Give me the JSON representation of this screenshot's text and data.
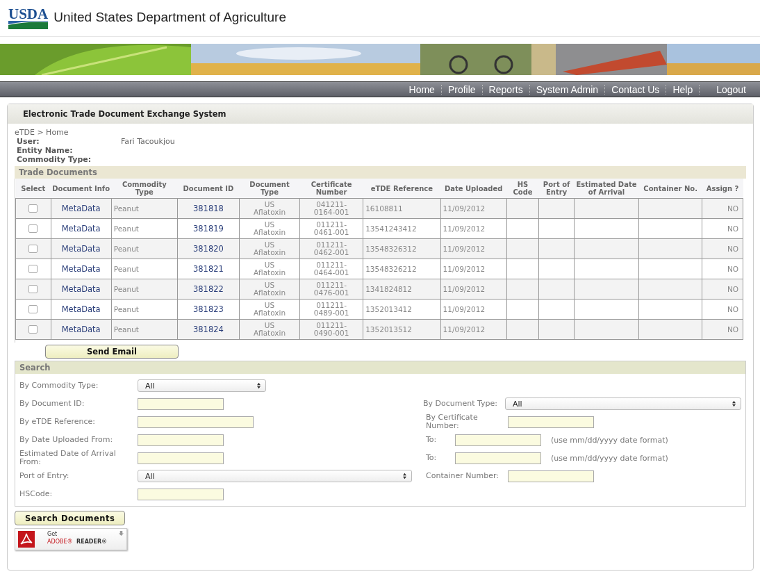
{
  "header": {
    "logo": "USDA",
    "title": "United States Department of Agriculture"
  },
  "nav": {
    "items": [
      "Home",
      "Profile",
      "Reports",
      "System Admin",
      "Contact Us",
      "Help"
    ],
    "logout": "Logout"
  },
  "panel": {
    "title": "Electronic Trade Document Exchange System",
    "breadcrumb": "eTDE > Home",
    "info": [
      {
        "label": "User:",
        "value": "Fari Tacoukjou"
      },
      {
        "label": "Entity Name:"
      },
      {
        "label": "Commodity Type:"
      }
    ]
  },
  "trade_documents": {
    "title": "Trade Documents",
    "columns": [
      "Select",
      "Document Info",
      "Commodity Type",
      "Document ID",
      "Document Type",
      "Certificate Number",
      "eTDE Reference",
      "Date Uploaded",
      "HS Code",
      "Port of Entry",
      "Estimated Date of Arrival",
      "Container No.",
      "Assign ?"
    ],
    "rows": [
      {
        "checked": false,
        "info": "MetaData",
        "commodity": "Peanut",
        "document_id": "381818",
        "document_type": "US Aflatoxin",
        "certificate_number": "041211-0164-001",
        "etde_reference": "16108811",
        "date_uploaded": "11/09/2012",
        "assign": "NO"
      },
      {
        "checked": false,
        "info": "MetaData",
        "commodity": "Peanut",
        "document_id": "381819",
        "document_type": "US Aflatoxin",
        "certificate_number": "011211-0461-001",
        "etde_reference": "13541243412",
        "date_uploaded": "11/09/2012",
        "assign": "NO"
      },
      {
        "checked": false,
        "info": "MetaData",
        "commodity": "Peanut",
        "document_id": "381820",
        "document_type": "US Aflatoxin",
        "certificate_number": "011211-0462-001",
        "etde_reference": "13548326312",
        "date_uploaded": "11/09/2012",
        "assign": "NO"
      },
      {
        "checked": false,
        "info": "MetaData",
        "commodity": "Peanut",
        "document_id": "381821",
        "document_type": "US Aflatoxin",
        "certificate_number": "011211-0464-001",
        "etde_reference": "13548326212",
        "date_uploaded": "11/09/2012",
        "assign": "NO"
      },
      {
        "checked": false,
        "info": "MetaData",
        "commodity": "Peanut",
        "document_id": "381822",
        "document_type": "US Aflatoxin",
        "certificate_number": "011211-0476-001",
        "etde_reference": "1341824812",
        "date_uploaded": "11/09/2012",
        "assign": "NO"
      },
      {
        "checked": false,
        "info": "MetaData",
        "commodity": "Peanut",
        "document_id": "381823",
        "document_type": "US Aflatoxin",
        "certificate_number": "011211-0489-001",
        "etde_reference": "1352013412",
        "date_uploaded": "11/09/2012",
        "assign": "NO"
      },
      {
        "checked": false,
        "info": "MetaData",
        "commodity": "Peanut",
        "document_id": "381824",
        "document_type": "US Aflatoxin",
        "certificate_number": "011211-0490-001",
        "etde_reference": "1352013512",
        "date_uploaded": "11/09/2012",
        "assign": "NO"
      }
    ],
    "send_button": "Send Email"
  },
  "search": {
    "title": "Search",
    "rows": [
      {
        "left": {
          "kind": "select",
          "label": "By Commodity Type:",
          "value": "All"
        }
      },
      {
        "left": {
          "kind": "text",
          "label": "By Document ID:"
        },
        "right": {
          "kind": "select",
          "label": "By Document Type:",
          "value": "All"
        }
      },
      {
        "left": {
          "kind": "text",
          "label": "By eTDE Reference:"
        },
        "right": {
          "kind": "text",
          "label": "By Certificate Number:"
        }
      },
      {
        "left": {
          "kind": "text",
          "label": "By Date Uploaded From:"
        },
        "right": {
          "kind": "date_to",
          "label": "To:",
          "hint": "(use mm/dd/yyyy date format)"
        }
      },
      {
        "left": {
          "kind": "text",
          "label": "Estimated Date of Arrival From:"
        },
        "right": {
          "kind": "date_to",
          "label": "To:",
          "hint": "(use mm/dd/yyyy date format)"
        }
      },
      {
        "left": {
          "kind": "select",
          "label": "Port of Entry:",
          "value": "All"
        },
        "right": {
          "kind": "text",
          "label": "Container Number:"
        }
      },
      {
        "left": {
          "kind": "text",
          "label": "HSCode:"
        }
      }
    ],
    "button": "Search Documents"
  },
  "adobe_badge": {
    "get": "Get",
    "brand": "ADOBE®",
    "product": "READER®"
  }
}
